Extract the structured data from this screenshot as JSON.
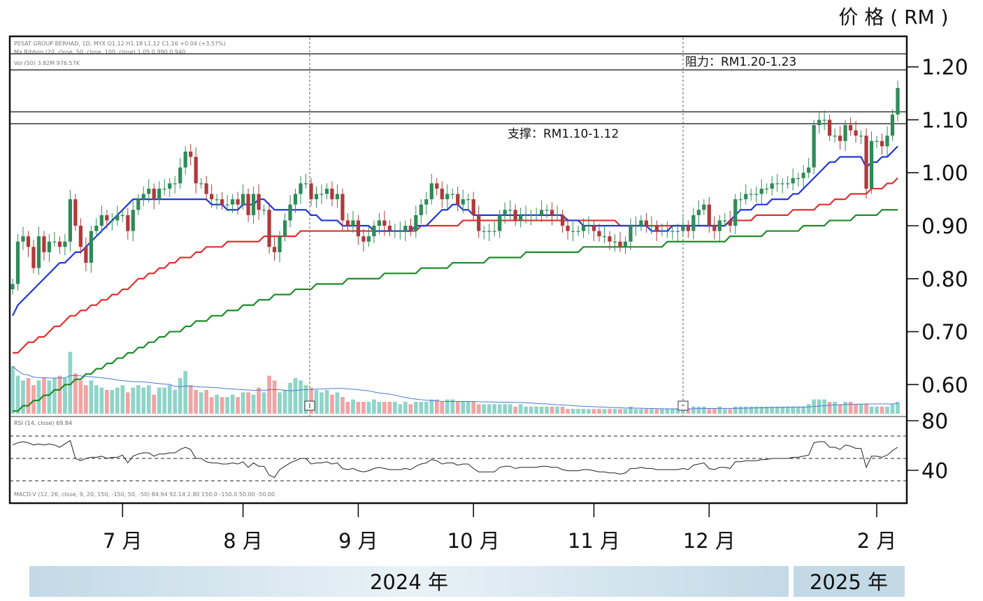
{
  "chart_data": {
    "type": "candlestick",
    "price_unit_label": "价 格 ( RM )",
    "indicator_lines": {
      "header": "PESAT GROUP BERHAD, 1D, MYX  O1.12  H1.18  L1.12  C1.16  +0.04 (+3.57%)",
      "ma_legend": "Ma Ribbon (20, close, 50, close, 100, close)  1.05  0.990  0.940",
      "volume": "Vol (50)  3.82M  976.57K",
      "rsi": "RSI (14, close)  69.84",
      "macd": "MACD-V (12, 26, close, 9, 20, 150, -150, 50, -50)  84.94  92.14  2.80  150.0  -150.0  50.00  -50.00"
    },
    "resistance": {
      "label": "阻力：RM1.20-1.23",
      "low": 1.2,
      "high": 1.23
    },
    "support": {
      "label": "支撑：RM1.10-1.12",
      "low": 1.1,
      "high": 1.12
    },
    "price_axis": {
      "ticks": [
        "1.20",
        "1.10",
        "1.00",
        "0.90",
        "0.80",
        "0.70",
        "0.60"
      ],
      "ylim": [
        0.545,
        1.255
      ]
    },
    "rsi_axis": {
      "ticks": [
        "80",
        "40"
      ]
    },
    "months": [
      {
        "label": "7 月",
        "index": 21
      },
      {
        "label": "8 月",
        "index": 44
      },
      {
        "label": "9 月",
        "index": 66
      },
      {
        "label": "10 月",
        "index": 88
      },
      {
        "label": "11 月",
        "index": 111
      },
      {
        "label": "12 月",
        "index": 133
      },
      {
        "label": "2 月",
        "index": 165
      }
    ],
    "years": [
      {
        "label": "2024 年"
      },
      {
        "label": "2025 年"
      }
    ],
    "closes": [
      0.79,
      0.87,
      0.88,
      0.86,
      0.82,
      0.88,
      0.85,
      0.87,
      0.87,
      0.86,
      0.87,
      0.95,
      0.9,
      0.86,
      0.83,
      0.89,
      0.9,
      0.92,
      0.91,
      0.91,
      0.92,
      0.92,
      0.89,
      0.93,
      0.95,
      0.96,
      0.97,
      0.95,
      0.97,
      0.97,
      0.98,
      0.98,
      1.01,
      1.04,
      1.03,
      0.98,
      0.98,
      0.96,
      0.95,
      0.95,
      0.94,
      0.94,
      0.95,
      0.94,
      0.96,
      0.92,
      0.96,
      0.93,
      0.93,
      0.86,
      0.85,
      0.88,
      0.91,
      0.94,
      0.96,
      0.98,
      0.98,
      0.95,
      0.96,
      0.96,
      0.97,
      0.95,
      0.96,
      0.91,
      0.9,
      0.91,
      0.88,
      0.87,
      0.88,
      0.9,
      0.91,
      0.9,
      0.89,
      0.89,
      0.89,
      0.9,
      0.89,
      0.92,
      0.94,
      0.95,
      0.98,
      0.97,
      0.95,
      0.96,
      0.96,
      0.94,
      0.95,
      0.95,
      0.92,
      0.89,
      0.89,
      0.89,
      0.89,
      0.92,
      0.93,
      0.93,
      0.91,
      0.92,
      0.92,
      0.92,
      0.92,
      0.93,
      0.93,
      0.92,
      0.92,
      0.9,
      0.89,
      0.89,
      0.89,
      0.9,
      0.9,
      0.89,
      0.88,
      0.88,
      0.87,
      0.87,
      0.86,
      0.87,
      0.9,
      0.9,
      0.91,
      0.9,
      0.9,
      0.89,
      0.89,
      0.89,
      0.89,
      0.89,
      0.9,
      0.89,
      0.92,
      0.93,
      0.94,
      0.9,
      0.89,
      0.91,
      0.91,
      0.9,
      0.95,
      0.95,
      0.96,
      0.96,
      0.96,
      0.97,
      0.97,
      0.98,
      0.98,
      0.98,
      0.98,
      0.99,
      0.99,
      1.0,
      1.01,
      1.09,
      1.1,
      1.1,
      1.07,
      1.07,
      1.06,
      1.09,
      1.08,
      1.07,
      1.07,
      0.97,
      1.06,
      1.06,
      1.05,
      1.07,
      1.11,
      1.16
    ],
    "ma20": [
      0.73,
      0.75,
      0.76,
      0.77,
      0.78,
      0.79,
      0.8,
      0.81,
      0.82,
      0.83,
      0.83,
      0.84,
      0.85,
      0.85,
      0.86,
      0.87,
      0.88,
      0.89,
      0.9,
      0.91,
      0.92,
      0.93,
      0.94,
      0.95,
      0.95,
      0.95,
      0.95,
      0.95,
      0.95,
      0.95,
      0.95,
      0.95,
      0.95,
      0.95,
      0.95,
      0.95,
      0.95,
      0.95,
      0.94,
      0.94,
      0.94,
      0.93,
      0.93,
      0.93,
      0.94,
      0.94,
      0.94,
      0.95,
      0.95,
      0.94,
      0.93,
      0.93,
      0.93,
      0.93,
      0.93,
      0.93,
      0.93,
      0.92,
      0.92,
      0.91,
      0.91,
      0.91,
      0.91,
      0.9,
      0.9,
      0.9,
      0.9,
      0.9,
      0.9,
      0.89,
      0.89,
      0.89,
      0.89,
      0.89,
      0.89,
      0.89,
      0.89,
      0.9,
      0.9,
      0.9,
      0.91,
      0.92,
      0.93,
      0.93,
      0.94,
      0.94,
      0.93,
      0.93,
      0.92,
      0.92,
      0.92,
      0.92,
      0.92,
      0.92,
      0.92,
      0.92,
      0.92,
      0.92,
      0.92,
      0.92,
      0.92,
      0.92,
      0.92,
      0.92,
      0.92,
      0.92,
      0.91,
      0.91,
      0.91,
      0.9,
      0.9,
      0.9,
      0.9,
      0.9,
      0.9,
      0.9,
      0.9,
      0.9,
      0.9,
      0.9,
      0.9,
      0.9,
      0.89,
      0.89,
      0.89,
      0.89,
      0.9,
      0.9,
      0.9,
      0.9,
      0.9,
      0.9,
      0.9,
      0.9,
      0.9,
      0.9,
      0.9,
      0.91,
      0.92,
      0.93,
      0.93,
      0.93,
      0.94,
      0.94,
      0.94,
      0.95,
      0.95,
      0.95,
      0.95,
      0.96,
      0.96,
      0.97,
      0.98,
      0.99,
      1.0,
      1.01,
      1.02,
      1.02,
      1.03,
      1.03,
      1.03,
      1.03,
      1.03,
      1.01,
      1.02,
      1.02,
      1.03,
      1.03,
      1.04,
      1.05
    ],
    "ma50": [
      0.66,
      0.66,
      0.67,
      0.68,
      0.68,
      0.69,
      0.69,
      0.7,
      0.71,
      0.71,
      0.72,
      0.73,
      0.73,
      0.74,
      0.74,
      0.75,
      0.75,
      0.76,
      0.76,
      0.77,
      0.77,
      0.78,
      0.78,
      0.79,
      0.8,
      0.8,
      0.81,
      0.81,
      0.82,
      0.82,
      0.83,
      0.83,
      0.84,
      0.84,
      0.84,
      0.85,
      0.85,
      0.86,
      0.86,
      0.86,
      0.86,
      0.87,
      0.87,
      0.87,
      0.87,
      0.87,
      0.87,
      0.87,
      0.88,
      0.88,
      0.88,
      0.88,
      0.88,
      0.88,
      0.88,
      0.89,
      0.89,
      0.89,
      0.89,
      0.89,
      0.89,
      0.89,
      0.89,
      0.89,
      0.89,
      0.89,
      0.89,
      0.89,
      0.89,
      0.89,
      0.89,
      0.89,
      0.89,
      0.89,
      0.89,
      0.89,
      0.89,
      0.89,
      0.9,
      0.9,
      0.9,
      0.9,
      0.9,
      0.9,
      0.9,
      0.9,
      0.91,
      0.91,
      0.91,
      0.91,
      0.91,
      0.91,
      0.91,
      0.91,
      0.91,
      0.91,
      0.91,
      0.91,
      0.91,
      0.91,
      0.91,
      0.91,
      0.91,
      0.91,
      0.91,
      0.91,
      0.91,
      0.91,
      0.91,
      0.91,
      0.91,
      0.91,
      0.91,
      0.91,
      0.91,
      0.91,
      0.9,
      0.9,
      0.9,
      0.9,
      0.9,
      0.9,
      0.9,
      0.9,
      0.9,
      0.9,
      0.9,
      0.9,
      0.9,
      0.9,
      0.9,
      0.9,
      0.9,
      0.9,
      0.9,
      0.9,
      0.9,
      0.91,
      0.91,
      0.91,
      0.91,
      0.91,
      0.92,
      0.92,
      0.92,
      0.92,
      0.92,
      0.92,
      0.92,
      0.93,
      0.93,
      0.93,
      0.93,
      0.93,
      0.94,
      0.94,
      0.94,
      0.95,
      0.95,
      0.95,
      0.96,
      0.96,
      0.96,
      0.96,
      0.97,
      0.97,
      0.97,
      0.98,
      0.98,
      0.99
    ],
    "ma100": [
      0.55,
      0.55,
      0.56,
      0.56,
      0.57,
      0.57,
      0.58,
      0.58,
      0.59,
      0.59,
      0.6,
      0.6,
      0.61,
      0.61,
      0.62,
      0.62,
      0.63,
      0.63,
      0.64,
      0.64,
      0.65,
      0.65,
      0.66,
      0.66,
      0.67,
      0.67,
      0.68,
      0.68,
      0.69,
      0.69,
      0.7,
      0.7,
      0.7,
      0.71,
      0.71,
      0.72,
      0.72,
      0.72,
      0.73,
      0.73,
      0.73,
      0.74,
      0.74,
      0.74,
      0.75,
      0.75,
      0.75,
      0.76,
      0.76,
      0.76,
      0.77,
      0.77,
      0.77,
      0.77,
      0.78,
      0.78,
      0.78,
      0.78,
      0.79,
      0.79,
      0.79,
      0.79,
      0.79,
      0.79,
      0.8,
      0.8,
      0.8,
      0.8,
      0.8,
      0.8,
      0.8,
      0.81,
      0.81,
      0.81,
      0.81,
      0.81,
      0.81,
      0.81,
      0.82,
      0.82,
      0.82,
      0.82,
      0.82,
      0.82,
      0.83,
      0.83,
      0.83,
      0.83,
      0.83,
      0.83,
      0.83,
      0.84,
      0.84,
      0.84,
      0.84,
      0.84,
      0.84,
      0.84,
      0.85,
      0.85,
      0.85,
      0.85,
      0.85,
      0.85,
      0.85,
      0.85,
      0.85,
      0.85,
      0.85,
      0.86,
      0.86,
      0.86,
      0.86,
      0.86,
      0.86,
      0.86,
      0.86,
      0.86,
      0.86,
      0.86,
      0.86,
      0.86,
      0.86,
      0.86,
      0.86,
      0.87,
      0.87,
      0.87,
      0.87,
      0.87,
      0.87,
      0.87,
      0.87,
      0.87,
      0.87,
      0.87,
      0.87,
      0.88,
      0.88,
      0.88,
      0.88,
      0.88,
      0.88,
      0.88,
      0.89,
      0.89,
      0.89,
      0.89,
      0.89,
      0.89,
      0.89,
      0.9,
      0.9,
      0.9,
      0.9,
      0.9,
      0.91,
      0.91,
      0.91,
      0.91,
      0.91,
      0.92,
      0.92,
      0.92,
      0.92,
      0.92,
      0.93,
      0.93,
      0.93,
      0.93
    ],
    "rsi": [
      72,
      74,
      75,
      74,
      72,
      73,
      72,
      73,
      72,
      70,
      73,
      76,
      60,
      58,
      60,
      61,
      61,
      62,
      60,
      61,
      61,
      63,
      56,
      62,
      64,
      65,
      65,
      62,
      64,
      64,
      65,
      65,
      68,
      70,
      68,
      60,
      60,
      57,
      56,
      56,
      55,
      55,
      56,
      55,
      57,
      52,
      56,
      53,
      53,
      45,
      43,
      50,
      53,
      56,
      58,
      60,
      60,
      55,
      56,
      56,
      57,
      55,
      56,
      51,
      50,
      51,
      49,
      48,
      49,
      51,
      52,
      51,
      50,
      50,
      50,
      51,
      50,
      53,
      55,
      56,
      59,
      58,
      55,
      56,
      56,
      54,
      55,
      55,
      51,
      48,
      48,
      48,
      48,
      52,
      53,
      53,
      51,
      52,
      52,
      52,
      52,
      53,
      53,
      52,
      52,
      50,
      49,
      49,
      49,
      50,
      50,
      49,
      48,
      48,
      47,
      47,
      46,
      47,
      51,
      51,
      52,
      51,
      51,
      50,
      50,
      50,
      50,
      50,
      51,
      50,
      54,
      55,
      56,
      51,
      50,
      52,
      52,
      51,
      57,
      57,
      58,
      58,
      58,
      59,
      59,
      60,
      60,
      60,
      60,
      61,
      61,
      62,
      63,
      74,
      75,
      75,
      70,
      70,
      68,
      72,
      71,
      69,
      69,
      52,
      62,
      62,
      61,
      63,
      67,
      70
    ],
    "volume": [
      2.0,
      1.6,
      1.4,
      1.5,
      1.2,
      1.4,
      1.5,
      1.4,
      1.5,
      1.6,
      1.5,
      2.6,
      1.7,
      1.4,
      1.2,
      1.4,
      1.2,
      1.1,
      1.0,
      1.0,
      1.1,
      1.2,
      0.9,
      1.1,
      1.2,
      1.1,
      1.2,
      0.8,
      1.1,
      1.1,
      1.2,
      1.0,
      1.5,
      1.8,
      1.2,
      1.0,
      0.9,
      1.0,
      0.7,
      0.8,
      0.7,
      0.7,
      0.8,
      0.7,
      0.9,
      0.9,
      0.8,
      1.1,
      0.9,
      1.6,
      1.4,
      0.9,
      1.0,
      1.3,
      1.5,
      1.4,
      1.2,
      1.1,
      1.0,
      0.9,
      1.0,
      0.8,
      0.9,
      0.7,
      0.5,
      0.6,
      0.5,
      0.5,
      0.5,
      0.6,
      0.5,
      0.5,
      0.5,
      0.5,
      0.4,
      0.5,
      0.4,
      0.5,
      0.5,
      0.5,
      0.6,
      0.6,
      0.5,
      0.6,
      0.6,
      0.5,
      0.5,
      0.5,
      0.5,
      0.4,
      0.4,
      0.4,
      0.4,
      0.4,
      0.4,
      0.4,
      0.3,
      0.4,
      0.3,
      0.3,
      0.3,
      0.3,
      0.3,
      0.3,
      0.3,
      0.3,
      0.2,
      0.2,
      0.2,
      0.2,
      0.2,
      0.2,
      0.2,
      0.2,
      0.2,
      0.2,
      0.2,
      0.2,
      0.3,
      0.2,
      0.2,
      0.2,
      0.2,
      0.2,
      0.2,
      0.2,
      0.2,
      0.2,
      0.2,
      0.2,
      0.3,
      0.3,
      0.3,
      0.2,
      0.2,
      0.3,
      0.2,
      0.2,
      0.3,
      0.3,
      0.3,
      0.3,
      0.3,
      0.3,
      0.3,
      0.3,
      0.3,
      0.3,
      0.3,
      0.3,
      0.3,
      0.3,
      0.4,
      0.6,
      0.6,
      0.6,
      0.5,
      0.5,
      0.4,
      0.5,
      0.5,
      0.4,
      0.4,
      0.4,
      0.3,
      0.3,
      0.3,
      0.3,
      0.4,
      0.5
    ],
    "colors": {
      "ma20": "#1f37d9",
      "ma50": "#e0302f",
      "ma100": "#1e8c2a",
      "up": "#2e8b57",
      "down": "#b0393a",
      "vol_up": "#8fd4c8",
      "vol_down": "#f2a3a3",
      "vol_ma": "#4a78d8",
      "year_band": "#cfe1ec"
    }
  }
}
